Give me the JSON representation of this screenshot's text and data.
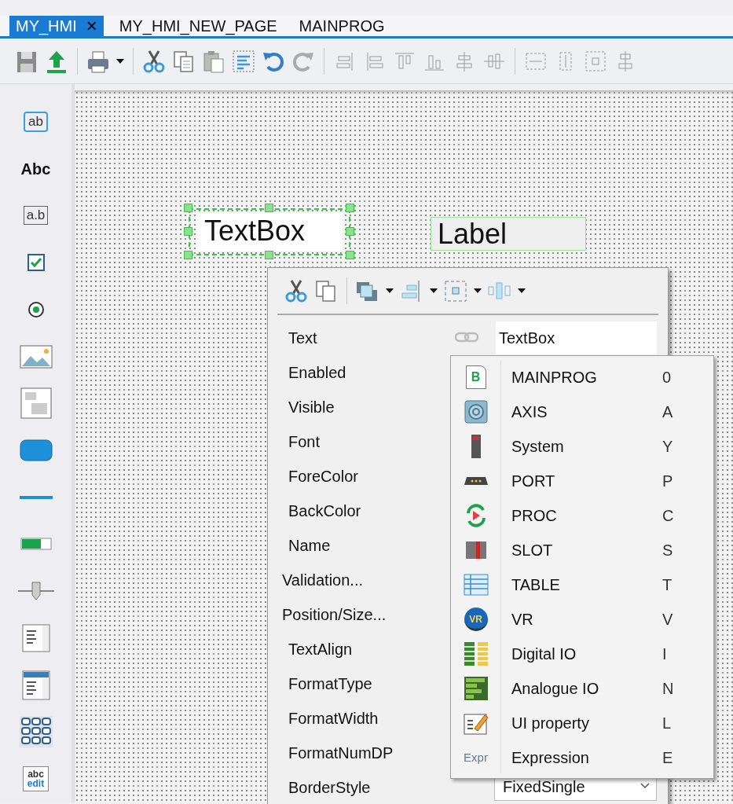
{
  "tabs": [
    {
      "label": "MY_HMI",
      "selected": true,
      "close": "×"
    },
    {
      "label": "MY_HMI_NEW_PAGE",
      "selected": false
    },
    {
      "label": "MAINPROG",
      "selected": false
    }
  ],
  "palette": [
    {
      "kind": "textbox",
      "text": "ab"
    },
    {
      "kind": "label",
      "text": "Abc"
    },
    {
      "kind": "editbox",
      "text": "a.b"
    },
    {
      "kind": "checkbox"
    },
    {
      "kind": "radio"
    },
    {
      "kind": "image"
    },
    {
      "kind": "panel"
    },
    {
      "kind": "button"
    },
    {
      "kind": "line"
    },
    {
      "kind": "progress"
    },
    {
      "kind": "slider"
    },
    {
      "kind": "listbox"
    },
    {
      "kind": "combobox"
    },
    {
      "kind": "grid"
    },
    {
      "kind": "textedit",
      "lines": [
        "abc",
        "edit"
      ]
    }
  ],
  "canvas": {
    "textbox": {
      "text": "TextBox",
      "selected": true
    },
    "label": {
      "text": "Label"
    }
  },
  "properties": {
    "rows": [
      {
        "label": "Text",
        "kind": "property",
        "value": "TextBox",
        "linked": true
      },
      {
        "label": "Enabled",
        "kind": "property"
      },
      {
        "label": "Visible",
        "kind": "property"
      },
      {
        "label": "Font",
        "kind": "property"
      },
      {
        "label": "ForeColor",
        "kind": "property"
      },
      {
        "label": "BackColor",
        "kind": "property"
      },
      {
        "label": "Name",
        "kind": "property"
      },
      {
        "label": "Validation...",
        "kind": "action"
      },
      {
        "label": "Position/Size...",
        "kind": "action"
      },
      {
        "label": "TextAlign",
        "kind": "property"
      },
      {
        "label": "FormatType",
        "kind": "property"
      },
      {
        "label": "FormatWidth",
        "kind": "property"
      },
      {
        "label": "FormatNumDP",
        "kind": "property"
      },
      {
        "label": "BorderStyle",
        "kind": "dropdown",
        "value": "FixedSingle"
      }
    ]
  },
  "menu": [
    {
      "label": "MAINPROG",
      "shortcut": "0",
      "kind": "program",
      "icon_text": "B"
    },
    {
      "label": "AXIS",
      "shortcut": "A",
      "kind": "axis"
    },
    {
      "label": "System",
      "shortcut": "Y",
      "kind": "system"
    },
    {
      "label": "PORT",
      "shortcut": "P",
      "kind": "port"
    },
    {
      "label": "PROC",
      "shortcut": "C",
      "kind": "proc"
    },
    {
      "label": "SLOT",
      "shortcut": "S",
      "kind": "slot"
    },
    {
      "label": "TABLE",
      "shortcut": "T",
      "kind": "table"
    },
    {
      "label": "VR",
      "shortcut": "V",
      "kind": "vr",
      "icon_text": "VR"
    },
    {
      "label": "Digital IO",
      "shortcut": "I",
      "kind": "digital"
    },
    {
      "label": "Analogue IO",
      "shortcut": "N",
      "kind": "analogue"
    },
    {
      "label": "UI property",
      "shortcut": "L",
      "kind": "uiprop"
    },
    {
      "label": "Expression",
      "shortcut": "E",
      "kind": "expr",
      "icon_text": "Expr"
    }
  ]
}
